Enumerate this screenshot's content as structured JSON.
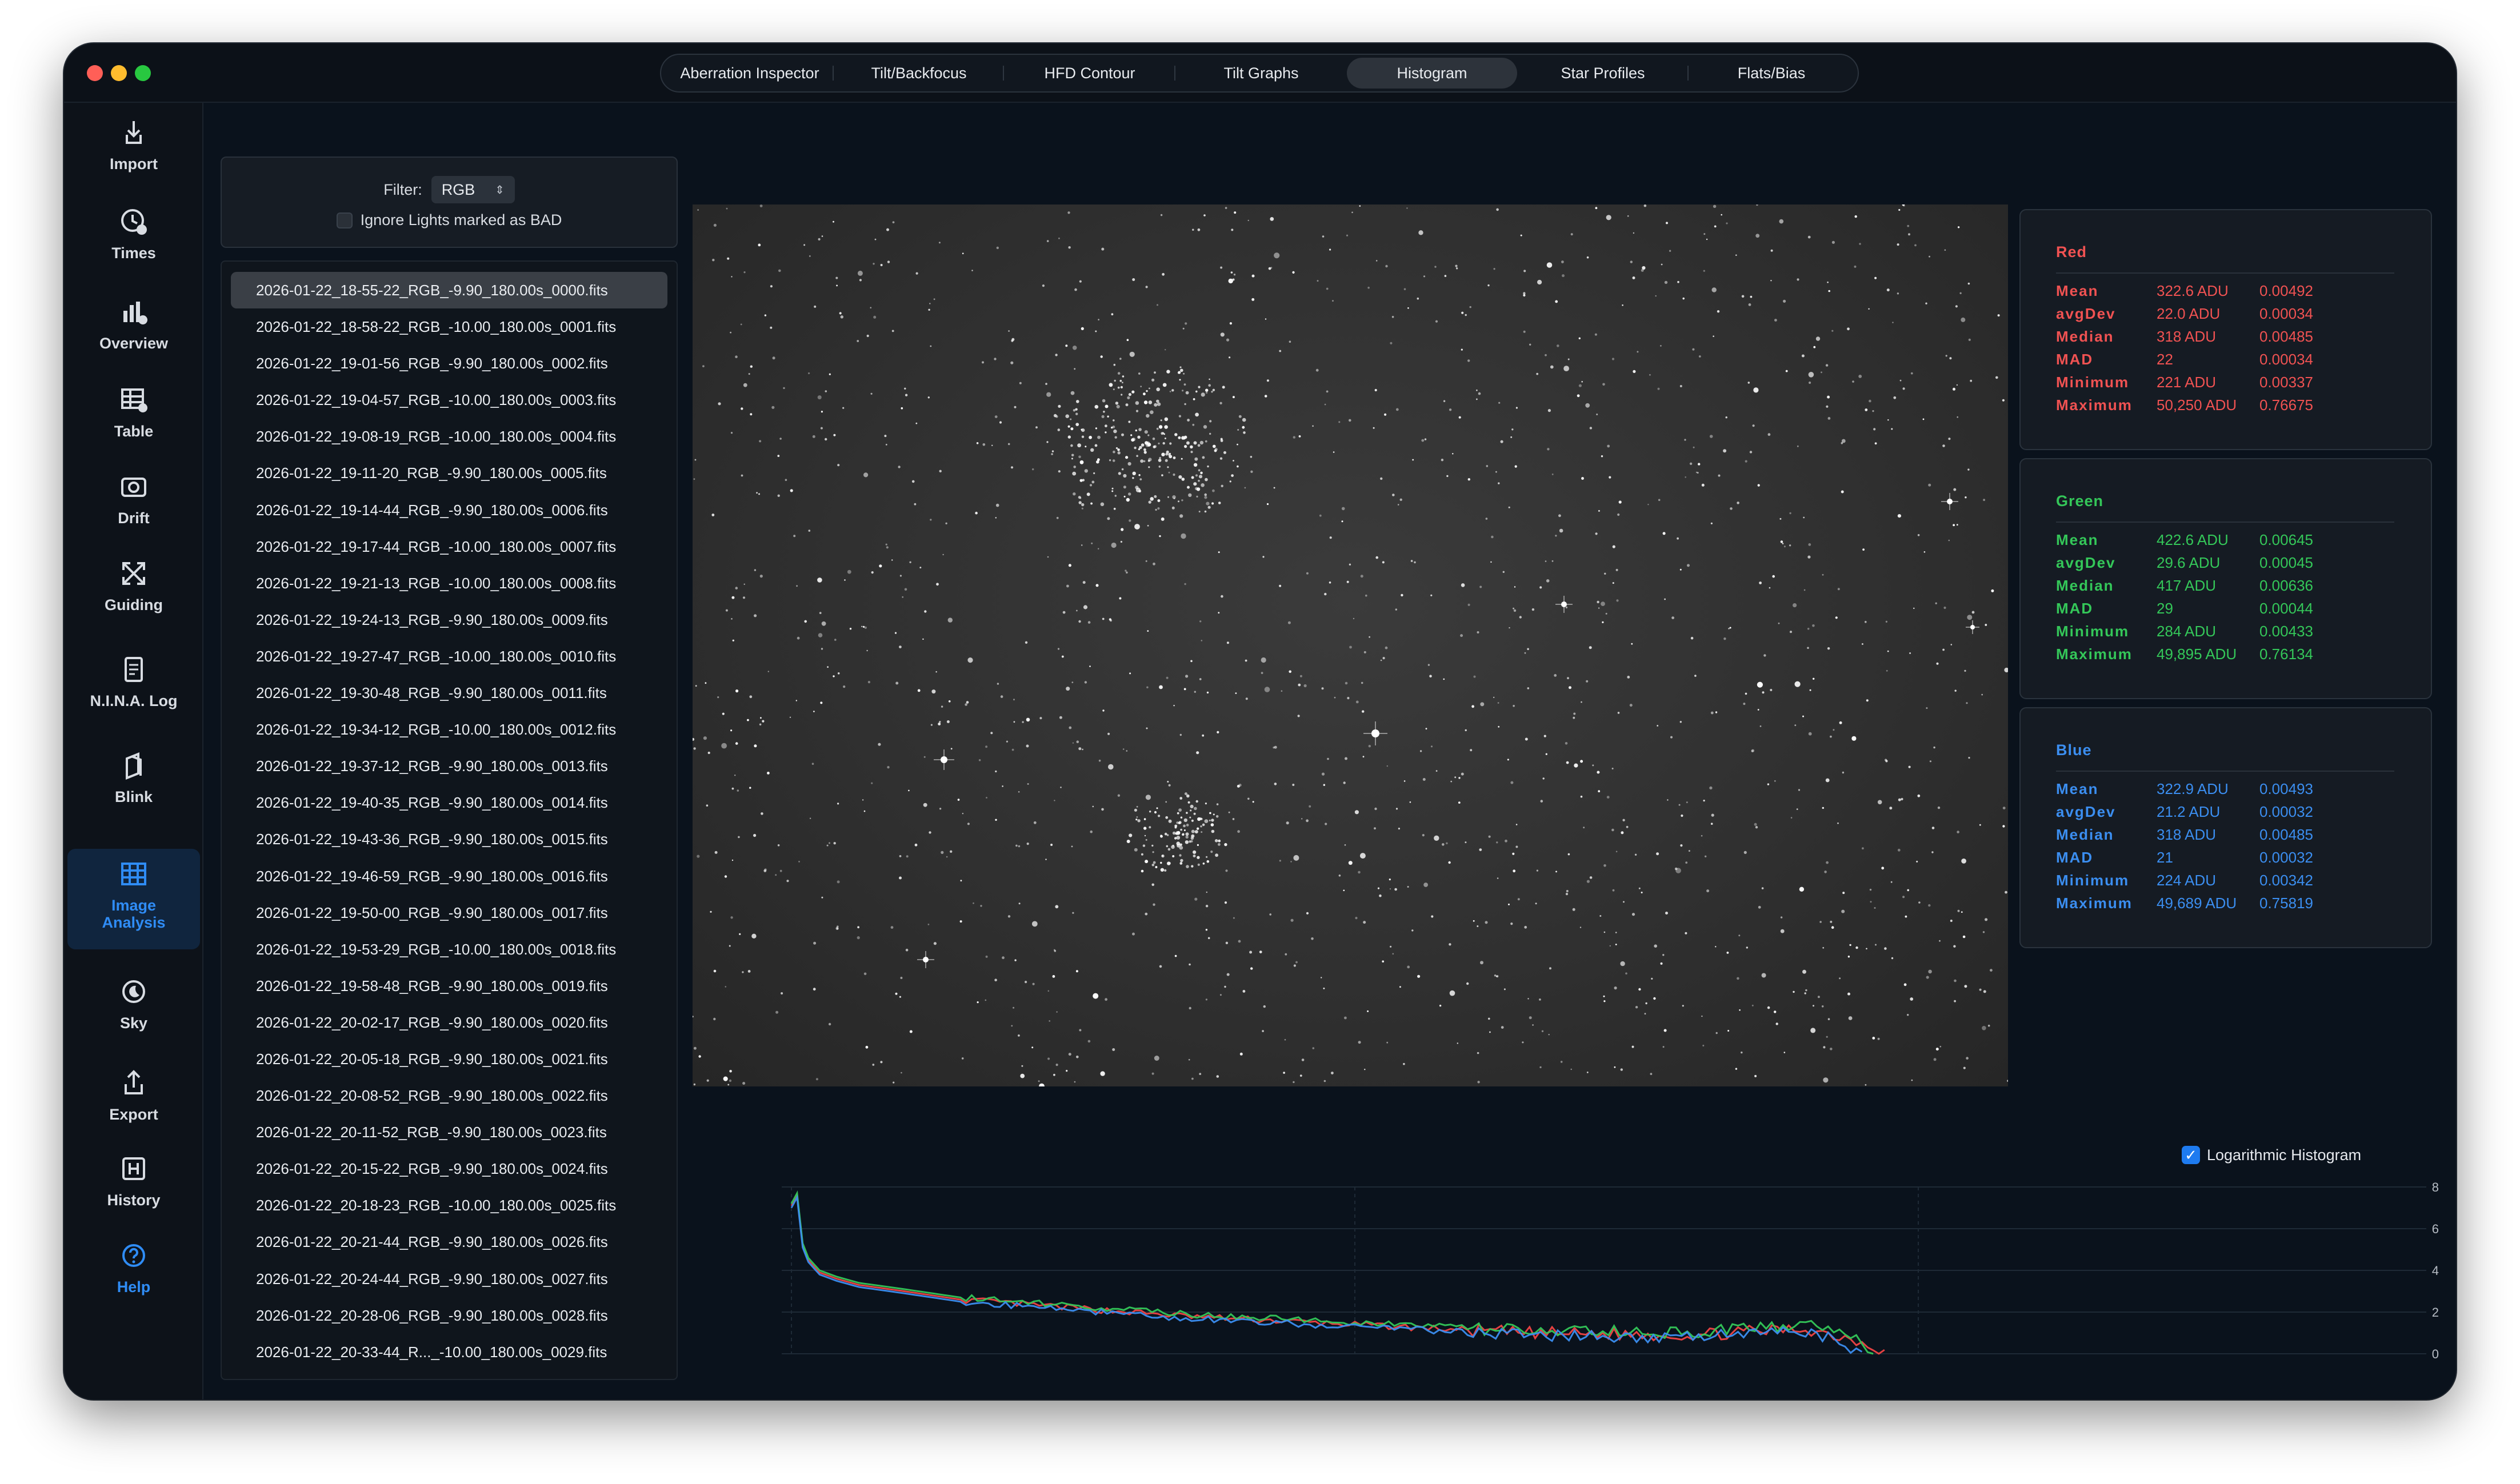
{
  "window": {
    "tabs": [
      {
        "label": "Aberration Inspector",
        "active": false
      },
      {
        "label": "Tilt/Backfocus",
        "active": false
      },
      {
        "label": "HFD Contour",
        "active": false
      },
      {
        "label": "Tilt Graphs",
        "active": false
      },
      {
        "label": "Histogram",
        "active": true
      },
      {
        "label": "Star Profiles",
        "active": false
      },
      {
        "label": "Flats/Bias",
        "active": false
      }
    ]
  },
  "sidebar": {
    "items": [
      {
        "label": "Import",
        "icon": "import-icon"
      },
      {
        "label": "Times",
        "icon": "clock-icon"
      },
      {
        "label": "Overview",
        "icon": "bar-chart-icon"
      },
      {
        "label": "Table",
        "icon": "table-icon"
      },
      {
        "label": "Drift",
        "icon": "camera-icon"
      },
      {
        "label": "Guiding",
        "icon": "arrows-icon"
      },
      {
        "label": "N.I.N.A. Log",
        "icon": "document-icon"
      },
      {
        "label": "Blink",
        "icon": "layers-icon"
      },
      {
        "label": "Image Analysis",
        "icon": "grid-icon",
        "active": true
      },
      {
        "label": "Sky",
        "icon": "moon-icon"
      },
      {
        "label": "Export",
        "icon": "export-icon"
      },
      {
        "label": "History",
        "icon": "history-icon"
      },
      {
        "label": "Help",
        "icon": "help-icon"
      }
    ]
  },
  "filter": {
    "label": "Filter:",
    "value": "RGB",
    "ignore_label": "Ignore Lights marked as BAD",
    "ignore_checked": false
  },
  "files": [
    "2026-01-22_18-55-22_RGB_-9.90_180.00s_0000.fits",
    "2026-01-22_18-58-22_RGB_-10.00_180.00s_0001.fits",
    "2026-01-22_19-01-56_RGB_-9.90_180.00s_0002.fits",
    "2026-01-22_19-04-57_RGB_-10.00_180.00s_0003.fits",
    "2026-01-22_19-08-19_RGB_-10.00_180.00s_0004.fits",
    "2026-01-22_19-11-20_RGB_-9.90_180.00s_0005.fits",
    "2026-01-22_19-14-44_RGB_-9.90_180.00s_0006.fits",
    "2026-01-22_19-17-44_RGB_-10.00_180.00s_0007.fits",
    "2026-01-22_19-21-13_RGB_-10.00_180.00s_0008.fits",
    "2026-01-22_19-24-13_RGB_-9.90_180.00s_0009.fits",
    "2026-01-22_19-27-47_RGB_-10.00_180.00s_0010.fits",
    "2026-01-22_19-30-48_RGB_-9.90_180.00s_0011.fits",
    "2026-01-22_19-34-12_RGB_-10.00_180.00s_0012.fits",
    "2026-01-22_19-37-12_RGB_-9.90_180.00s_0013.fits",
    "2026-01-22_19-40-35_RGB_-9.90_180.00s_0014.fits",
    "2026-01-22_19-43-36_RGB_-9.90_180.00s_0015.fits",
    "2026-01-22_19-46-59_RGB_-9.90_180.00s_0016.fits",
    "2026-01-22_19-50-00_RGB_-9.90_180.00s_0017.fits",
    "2026-01-22_19-53-29_RGB_-10.00_180.00s_0018.fits",
    "2026-01-22_19-58-48_RGB_-9.90_180.00s_0019.fits",
    "2026-01-22_20-02-17_RGB_-9.90_180.00s_0020.fits",
    "2026-01-22_20-05-18_RGB_-9.90_180.00s_0021.fits",
    "2026-01-22_20-08-52_RGB_-9.90_180.00s_0022.fits",
    "2026-01-22_20-11-52_RGB_-9.90_180.00s_0023.fits",
    "2026-01-22_20-15-22_RGB_-9.90_180.00s_0024.fits",
    "2026-01-22_20-18-23_RGB_-10.00_180.00s_0025.fits",
    "2026-01-22_20-21-44_RGB_-9.90_180.00s_0026.fits",
    "2026-01-22_20-24-44_RGB_-9.90_180.00s_0027.fits",
    "2026-01-22_20-28-06_RGB_-9.90_180.00s_0028.fits",
    "2026-01-22_20-33-44_R..._-10.00_180.00s_0029.fits"
  ],
  "selected_file_index": 0,
  "stats": [
    {
      "title": "Red",
      "color": "#f05252",
      "rows": [
        {
          "key": "Mean",
          "adu": "322.6 ADU",
          "norm": "0.00492"
        },
        {
          "key": "avgDev",
          "adu": "22.0 ADU",
          "norm": "0.00034"
        },
        {
          "key": "Median",
          "adu": "318 ADU",
          "norm": "0.00485"
        },
        {
          "key": "MAD",
          "adu": "22",
          "norm": "0.00034"
        },
        {
          "key": "Minimum",
          "adu": "221 ADU",
          "norm": "0.00337"
        },
        {
          "key": "Maximum",
          "adu": "50,250 ADU",
          "norm": "0.76675"
        }
      ]
    },
    {
      "title": "Green",
      "color": "#34c759",
      "rows": [
        {
          "key": "Mean",
          "adu": "422.6 ADU",
          "norm": "0.00645"
        },
        {
          "key": "avgDev",
          "adu": "29.6 ADU",
          "norm": "0.00045"
        },
        {
          "key": "Median",
          "adu": "417 ADU",
          "norm": "0.00636"
        },
        {
          "key": "MAD",
          "adu": "29",
          "norm": "0.00044"
        },
        {
          "key": "Minimum",
          "adu": "284 ADU",
          "norm": "0.00433"
        },
        {
          "key": "Maximum",
          "adu": "49,895 ADU",
          "norm": "0.76134"
        }
      ]
    },
    {
      "title": "Blue",
      "color": "#3b8ef0",
      "rows": [
        {
          "key": "Mean",
          "adu": "322.9 ADU",
          "norm": "0.00493"
        },
        {
          "key": "avgDev",
          "adu": "21.2 ADU",
          "norm": "0.00032"
        },
        {
          "key": "Median",
          "adu": "318 ADU",
          "norm": "0.00485"
        },
        {
          "key": "MAD",
          "adu": "21",
          "norm": "0.00032"
        },
        {
          "key": "Minimum",
          "adu": "224 ADU",
          "norm": "0.00342"
        },
        {
          "key": "Maximum",
          "adu": "49,689 ADU",
          "norm": "0.75819"
        }
      ]
    }
  ],
  "histogram": {
    "log_label": "Logarithmic Histogram",
    "log_checked": true,
    "x_ticks": [
      "0",
      "100",
      "200"
    ],
    "y_ticks": [
      "8",
      "6",
      "4",
      "2",
      "0"
    ]
  },
  "chart_data": {
    "type": "line",
    "xlim": [
      0,
      270
    ],
    "ylim": [
      0,
      8
    ],
    "grid": true,
    "x_ticks": [
      0,
      100,
      200
    ],
    "y_ticks": [
      0,
      2,
      4,
      6,
      8
    ],
    "series": [
      {
        "color": "#f04545",
        "x": [
          0,
          1,
          2,
          3,
          5,
          8,
          12,
          20,
          30,
          50,
          70,
          100,
          130,
          160,
          180,
          190,
          194
        ],
        "y": [
          7.1,
          7.6,
          5.2,
          4.5,
          3.9,
          3.6,
          3.3,
          3.0,
          2.6,
          2.2,
          1.8,
          1.4,
          1.0,
          0.9,
          1.2,
          0.6,
          0.1
        ]
      },
      {
        "color": "#34c759",
        "x": [
          0,
          1,
          2,
          3,
          5,
          8,
          12,
          20,
          30,
          50,
          70,
          100,
          130,
          160,
          180,
          188,
          192
        ],
        "y": [
          7.2,
          7.7,
          5.3,
          4.6,
          4.0,
          3.7,
          3.4,
          3.1,
          2.7,
          2.3,
          1.9,
          1.5,
          1.1,
          1.0,
          1.4,
          0.9,
          0.0
        ]
      },
      {
        "color": "#3b8ef0",
        "x": [
          0,
          1,
          2,
          3,
          5,
          8,
          12,
          20,
          30,
          50,
          70,
          100,
          130,
          160,
          180,
          187,
          190
        ],
        "y": [
          7.0,
          7.5,
          5.1,
          4.4,
          3.8,
          3.5,
          3.2,
          2.9,
          2.5,
          2.1,
          1.7,
          1.3,
          0.9,
          0.8,
          1.1,
          0.5,
          0.0
        ]
      }
    ]
  }
}
